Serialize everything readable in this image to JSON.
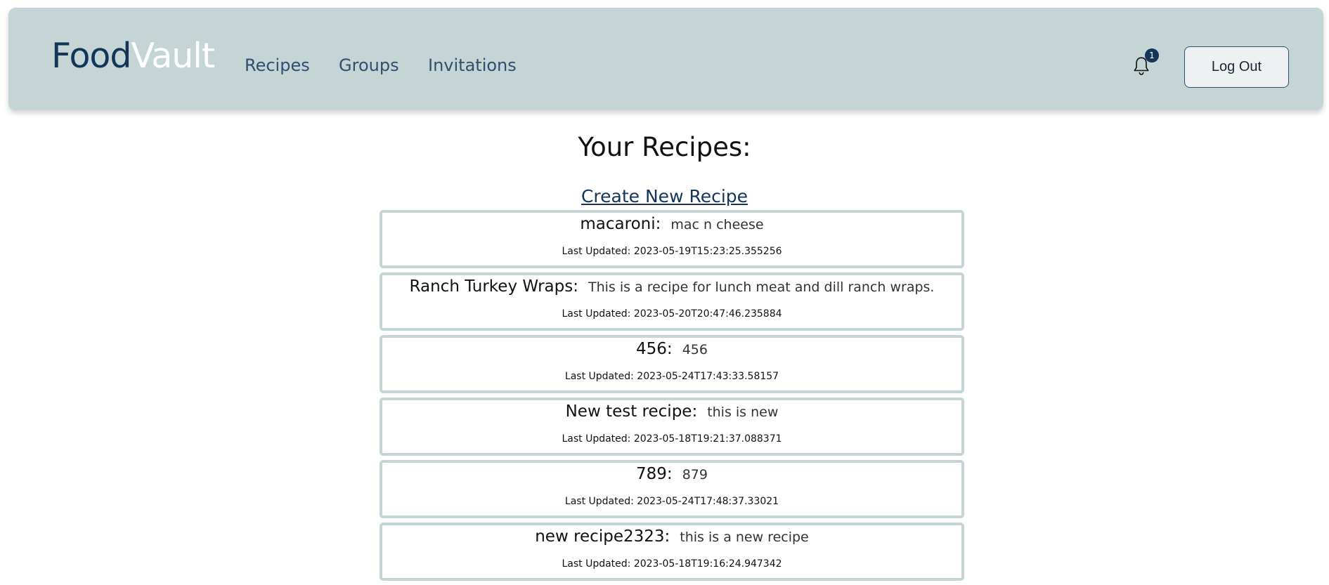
{
  "brand": {
    "part1": "Food",
    "part2": "Vault"
  },
  "nav": {
    "links": [
      {
        "label": "Recipes"
      },
      {
        "label": "Groups"
      },
      {
        "label": "Invitations"
      }
    ]
  },
  "notifications": {
    "icon": "bell-icon",
    "count": "1"
  },
  "logout": {
    "label": "Log Out"
  },
  "page": {
    "title": "Your Recipes:",
    "create_link": "Create New Recipe"
  },
  "recipes": [
    {
      "name": "macaroni:",
      "description": "mac n cheese",
      "updated": "Last Updated: 2023-05-19T15:23:25.355256"
    },
    {
      "name": "Ranch Turkey Wraps:",
      "description": "This is a recipe for lunch meat and dill ranch wraps.",
      "updated": "Last Updated: 2023-05-20T20:47:46.235884"
    },
    {
      "name": "456:",
      "description": "456",
      "updated": "Last Updated: 2023-05-24T17:43:33.58157"
    },
    {
      "name": "New test recipe:",
      "description": "this is new",
      "updated": "Last Updated: 2023-05-18T19:21:37.088371"
    },
    {
      "name": "789:",
      "description": "879",
      "updated": "Last Updated: 2023-05-24T17:48:37.33021"
    },
    {
      "name": "new recipe2323:",
      "description": "this is a new recipe",
      "updated": "Last Updated: 2023-05-18T19:16:24.947342"
    }
  ],
  "colors": {
    "navbar_bg": "#c5d5d6",
    "brand_dark": "#14355a",
    "brand_light": "#ffffff",
    "card_border": "#c5d5d6"
  }
}
